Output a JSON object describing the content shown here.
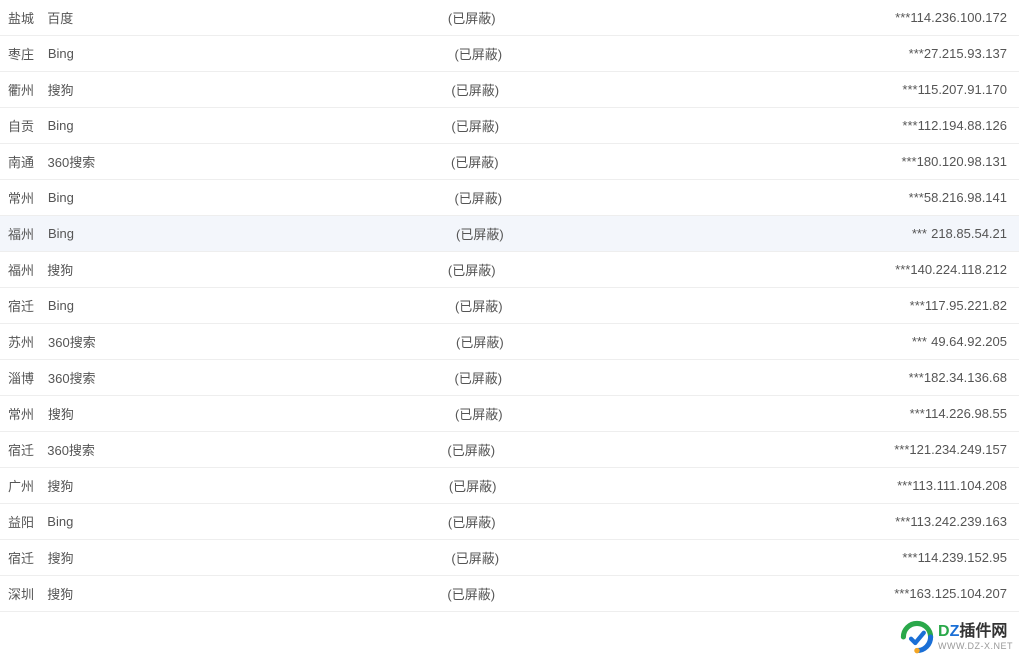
{
  "rows": [
    {
      "city": "盐城",
      "engine": "百度",
      "status": "(已屏蔽)",
      "stars": "***",
      "ip": "114.236.100.172",
      "highlight": false
    },
    {
      "city": "枣庄",
      "engine": "Bing",
      "status": "(已屏蔽)",
      "stars": "***",
      "ip": "27.215.93.137",
      "highlight": false
    },
    {
      "city": "衢州",
      "engine": "搜狗",
      "status": "(已屏蔽)",
      "stars": "***",
      "ip": "115.207.91.170",
      "highlight": false
    },
    {
      "city": "自贡",
      "engine": "Bing",
      "status": "(已屏蔽)",
      "stars": "***",
      "ip": "112.194.88.126",
      "highlight": false
    },
    {
      "city": "南通",
      "engine": "360搜索",
      "status": "(已屏蔽)",
      "stars": "***",
      "ip": "180.120.98.131",
      "highlight": false
    },
    {
      "city": "常州",
      "engine": "Bing",
      "status": "(已屏蔽)",
      "stars": "***",
      "ip": "58.216.98.141",
      "highlight": false
    },
    {
      "city": "福州",
      "engine": "Bing",
      "status": "(已屏蔽)",
      "stars": "***",
      "ip": "218.85.54.21",
      "highlight": true
    },
    {
      "city": "福州",
      "engine": "搜狗",
      "status": "(已屏蔽)",
      "stars": "***",
      "ip": "140.224.118.212",
      "highlight": false
    },
    {
      "city": "宿迁",
      "engine": "Bing",
      "status": "(已屏蔽)",
      "stars": "***",
      "ip": "117.95.221.82",
      "highlight": false
    },
    {
      "city": "苏州",
      "engine": "360搜索",
      "status": "(已屏蔽)",
      "stars": "***",
      "ip": "49.64.92.205",
      "highlight": false
    },
    {
      "city": "淄博",
      "engine": "360搜索",
      "status": "(已屏蔽)",
      "stars": "***",
      "ip": "182.34.136.68",
      "highlight": false
    },
    {
      "city": "常州",
      "engine": "搜狗",
      "status": "(已屏蔽)",
      "stars": "***",
      "ip": "114.226.98.55",
      "highlight": false
    },
    {
      "city": "宿迁",
      "engine": "360搜索",
      "status": "(已屏蔽)",
      "stars": "***",
      "ip": "121.234.249.157",
      "highlight": false
    },
    {
      "city": "广州",
      "engine": "搜狗",
      "status": "(已屏蔽)",
      "stars": "***",
      "ip": "113.111.104.208",
      "highlight": false
    },
    {
      "city": "益阳",
      "engine": "Bing",
      "status": "(已屏蔽)",
      "stars": "***",
      "ip": "113.242.239.163",
      "highlight": false
    },
    {
      "city": "宿迁",
      "engine": "搜狗",
      "status": "(已屏蔽)",
      "stars": "***",
      "ip": "114.239.152.95",
      "highlight": false
    },
    {
      "city": "深圳",
      "engine": "搜狗",
      "status": "(已屏蔽)",
      "stars": "***",
      "ip": "163.125.104.207",
      "highlight": false
    }
  ],
  "watermark": {
    "d": "D",
    "z": "Z",
    "cn": "插件网",
    "sub": "WWW.DZ-X.NET"
  }
}
